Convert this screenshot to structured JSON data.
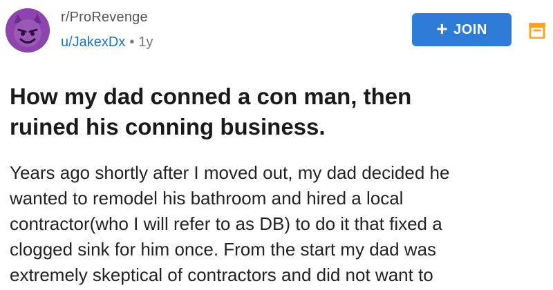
{
  "header": {
    "subreddit": "r/ProRevenge",
    "author": "u/JakexDx",
    "separator": "•",
    "age": "1y",
    "avatar_icon": "devil-face-icon",
    "join": {
      "icon": "plus-icon",
      "plus": "+",
      "label": "JOIN"
    },
    "save_icon": "bookmark-save-icon"
  },
  "post": {
    "title_lines": [
      "How my dad conned a con man, then",
      "ruined his conning business."
    ],
    "body_lines": [
      "Years ago shortly after I moved out, my dad decided he",
      "wanted to remodel his bathroom and hired a local",
      "contractor(who I will refer to as DB) to do it that fixed a",
      "clogged sink for him once.  From the start my dad was",
      "extremely skeptical of contractors and did not want to"
    ]
  },
  "colors": {
    "avatar": "#8e44ad",
    "join_button": "#2f7cd6",
    "link": "#1a73c8",
    "save_icon": "#f5a623"
  }
}
